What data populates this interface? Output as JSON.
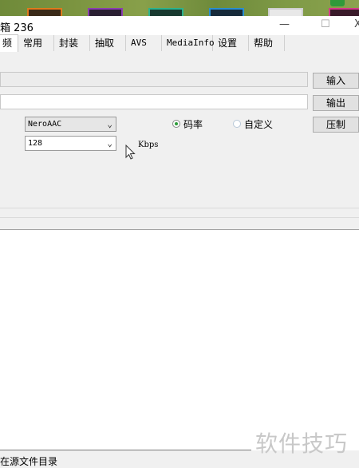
{
  "window": {
    "title": "箱 236",
    "minimize_glyph": "—",
    "maximize_glyph": "☐",
    "close_glyph": "X"
  },
  "tabs": [
    {
      "label": "频",
      "active": true
    },
    {
      "label": "常用"
    },
    {
      "label": "封装"
    },
    {
      "label": "抽取"
    },
    {
      "label": "AVS"
    },
    {
      "label": "MediaInfo"
    },
    {
      "label": "设置"
    },
    {
      "label": "帮助"
    }
  ],
  "audio": {
    "input_value": "",
    "output_value": "",
    "input_button": "输入",
    "output_button": "输出",
    "compress_button": "压制",
    "codec": {
      "selected": "NeroAAC"
    },
    "bitrate": {
      "selected": "128",
      "unit": "Kbps"
    },
    "mode": {
      "options": [
        {
          "label": "码率",
          "checked": true
        },
        {
          "label": "自定义",
          "checked": false
        }
      ]
    }
  },
  "footer": {
    "status_text": "在源文件目录"
  },
  "watermark": "软件技巧",
  "icons": {
    "chevron": "chevron-down-icon",
    "cursor": "mouse-pointer-icon"
  },
  "colors": {
    "radio_selected": "#2e9c3a",
    "window_bg": "#f0f0f0"
  }
}
